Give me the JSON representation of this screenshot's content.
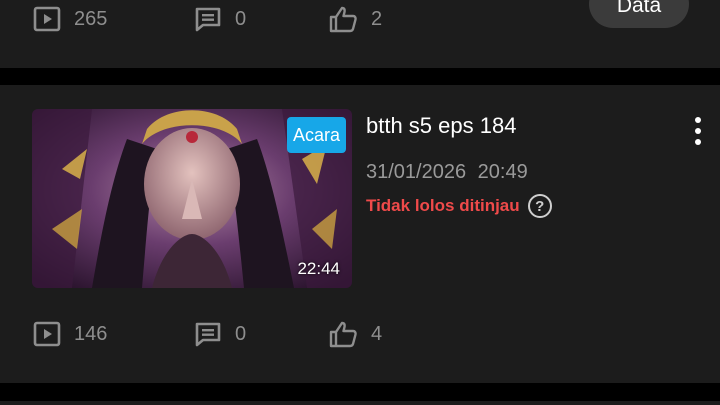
{
  "top_card": {
    "stats": {
      "views": "265",
      "comments": "0",
      "likes": "2"
    },
    "data_button_label": "Data"
  },
  "video": {
    "badge": "Acara",
    "duration": "22:44",
    "title": "btth s5 eps 184",
    "date": "31/01/2026",
    "time": "20:49",
    "status": "Tidak lolos ditinjau",
    "help_icon": "?",
    "stats": {
      "views": "146",
      "comments": "0",
      "likes": "4"
    }
  },
  "icons": {
    "views": "play-box-icon",
    "comments": "comment-icon",
    "likes": "thumbs-up-icon",
    "more": "more-vertical-icon"
  },
  "colors": {
    "background": "#000000",
    "card": "#1c1c1c",
    "badge": "#17a7e8",
    "status_error": "#ef4a4a",
    "muted_text": "#8e8e8e"
  }
}
